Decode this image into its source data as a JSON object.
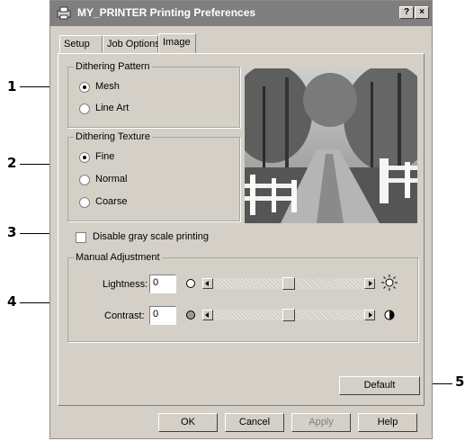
{
  "window": {
    "title": "MY_PRINTER   Printing Preferences",
    "help_button": "?",
    "close_button": "×"
  },
  "tabs": [
    {
      "label": "Setup"
    },
    {
      "label": "Job Options"
    },
    {
      "label": "Image",
      "active": true
    }
  ],
  "dithering_pattern": {
    "legend": "Dithering Pattern",
    "options": [
      {
        "label": "Mesh",
        "selected": true
      },
      {
        "label": "Line Art",
        "selected": false
      }
    ]
  },
  "dithering_texture": {
    "legend": "Dithering Texture",
    "options": [
      {
        "label": "Fine",
        "selected": true
      },
      {
        "label": "Normal",
        "selected": false
      },
      {
        "label": "Coarse",
        "selected": false
      }
    ]
  },
  "gray_scale": {
    "label": "Disable gray scale printing",
    "checked": false
  },
  "manual_adjustment": {
    "legend": "Manual Adjustment",
    "lightness": {
      "label": "Lightness:",
      "value": "0"
    },
    "contrast": {
      "label": "Contrast:",
      "value": "0"
    }
  },
  "buttons": {
    "default": "Default",
    "ok": "OK",
    "cancel": "Cancel",
    "apply": "Apply",
    "help": "Help"
  },
  "callouts": [
    "1",
    "2",
    "3",
    "4",
    "5"
  ],
  "colors": {
    "titlebar": "#7f7f7f",
    "dialog_bg": "#d4d0c8"
  }
}
